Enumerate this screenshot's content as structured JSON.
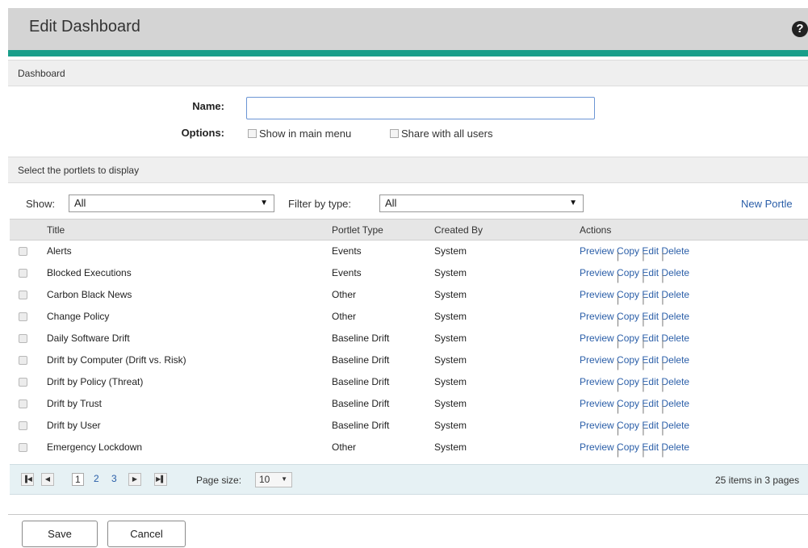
{
  "header": {
    "title": "Edit Dashboard",
    "help_glyph": "?"
  },
  "dashboard_section": {
    "title": "Dashboard",
    "name_label": "Name:",
    "name_value": "",
    "options_label": "Options:",
    "option_main_menu": "Show in main menu",
    "option_share": "Share with all users"
  },
  "portlets_section": {
    "title": "Select the portlets to display",
    "show_label": "Show:",
    "show_value": "All",
    "filter_label": "Filter by type:",
    "filter_value": "All",
    "new_portlet": "New Portle"
  },
  "table": {
    "headers": {
      "title": "Title",
      "type": "Portlet Type",
      "created_by": "Created By",
      "actions": "Actions"
    },
    "action_labels": {
      "preview": "Preview",
      "copy": "Copy",
      "edit": "Edit",
      "delete": "Delete",
      "separator": "|"
    },
    "rows": [
      {
        "title": "Alerts",
        "type": "Events",
        "created_by": "System"
      },
      {
        "title": "Blocked Executions",
        "type": "Events",
        "created_by": "System"
      },
      {
        "title": "Carbon Black News",
        "type": "Other",
        "created_by": "System"
      },
      {
        "title": "Change Policy",
        "type": "Other",
        "created_by": "System"
      },
      {
        "title": "Daily Software Drift",
        "type": "Baseline Drift",
        "created_by": "System"
      },
      {
        "title": "Drift by Computer (Drift vs. Risk)",
        "type": "Baseline Drift",
        "created_by": "System"
      },
      {
        "title": "Drift by Policy (Threat)",
        "type": "Baseline Drift",
        "created_by": "System"
      },
      {
        "title": "Drift by Trust",
        "type": "Baseline Drift",
        "created_by": "System"
      },
      {
        "title": "Drift by User",
        "type": "Baseline Drift",
        "created_by": "System"
      },
      {
        "title": "Emergency Lockdown",
        "type": "Other",
        "created_by": "System"
      }
    ]
  },
  "pager": {
    "pages": [
      "1",
      "2",
      "3"
    ],
    "current_page": "1",
    "page_size_label": "Page size:",
    "page_size": "10",
    "info": "25 items in 3 pages"
  },
  "buttons": {
    "save": "Save",
    "cancel": "Cancel"
  },
  "colors": {
    "accent": "#1a9e8a",
    "link": "#2a5ea8",
    "header_bg": "#d4d4d4"
  }
}
